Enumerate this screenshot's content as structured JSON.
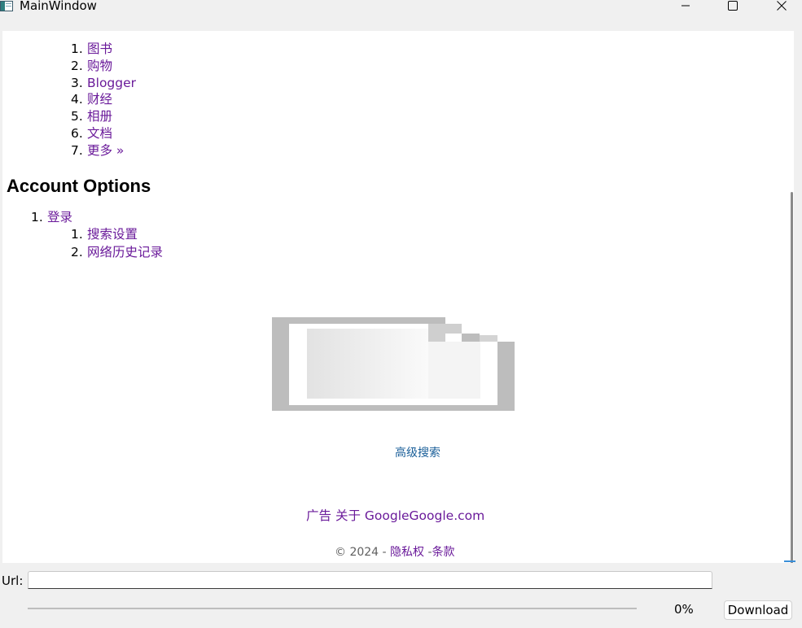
{
  "window": {
    "title": "MainWindow",
    "minimize_icon": "minimize-icon",
    "maximize_icon": "maximize-icon",
    "close_icon": "close-icon"
  },
  "page": {
    "nav_items": [
      {
        "num": "1.",
        "label": "图书"
      },
      {
        "num": "2.",
        "label": "购物"
      },
      {
        "num": "3.",
        "label": "Blogger"
      },
      {
        "num": "4.",
        "label": "财经"
      },
      {
        "num": "5.",
        "label": "相册"
      },
      {
        "num": "6.",
        "label": "文档"
      },
      {
        "num": "7.",
        "label": "更多 »"
      }
    ],
    "account_heading": "Account Options",
    "account_items": [
      {
        "num": "1.",
        "label": "登录"
      }
    ],
    "account_subitems": [
      {
        "num": "1.",
        "label": "搜索设置"
      },
      {
        "num": "2.",
        "label": "网络历史记录"
      }
    ],
    "broken_image_icon": "broken-image-icon",
    "advanced_search": "高级搜索",
    "ads_prefix": "广告",
    "about_link": "关于 Google",
    "site_link": "Google.com",
    "footer_copyright": "© 2024 -",
    "privacy_link": "隐私权",
    "footer_sep": "-",
    "terms_link": "条款"
  },
  "controls": {
    "url_label": "Url:",
    "url_value": "",
    "progress": {
      "percent": 0,
      "text": "0%"
    },
    "download_label": "Download",
    "accent_color": "#0067c0"
  },
  "colors": {
    "link_visited": "#6a1a9a",
    "link_blue": "#1a5f99"
  }
}
